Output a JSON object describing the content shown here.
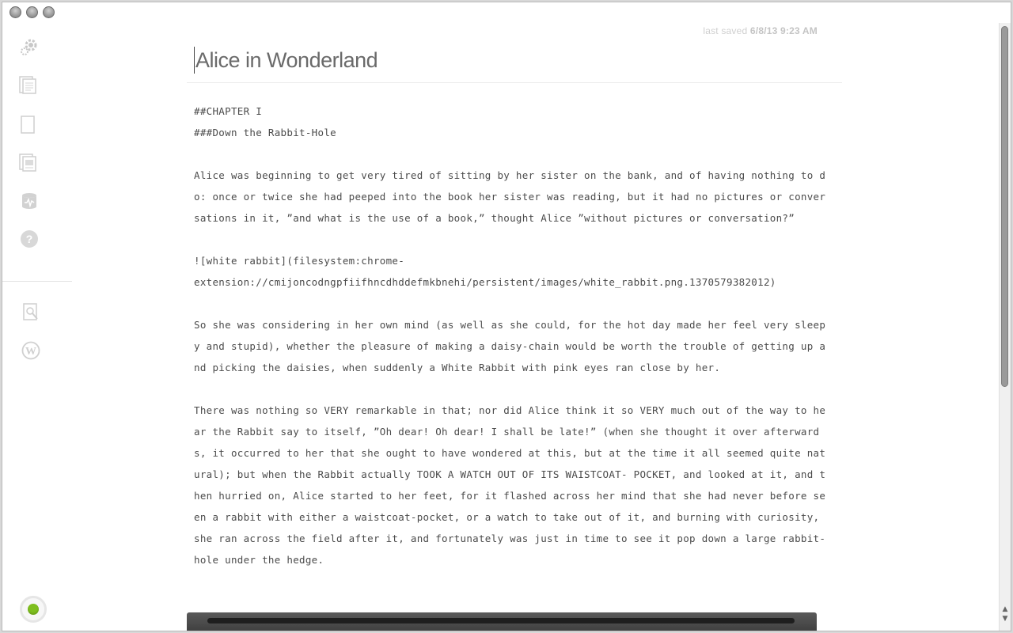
{
  "window": {
    "controls": [
      "close-button",
      "minimize-button",
      "zoom-button"
    ]
  },
  "sidebar": {
    "items": [
      {
        "name": "settings",
        "icon": "gear-icon"
      },
      {
        "name": "documents",
        "icon": "documents-icon"
      },
      {
        "name": "new-document",
        "icon": "blank-page-icon"
      },
      {
        "name": "gallery",
        "icon": "image-pages-icon"
      },
      {
        "name": "storage",
        "icon": "database-icon"
      },
      {
        "name": "help",
        "icon": "help-icon"
      }
    ],
    "tools": [
      {
        "name": "preview",
        "icon": "preview-icon"
      },
      {
        "name": "wordpress",
        "icon": "wordpress-icon"
      }
    ],
    "status_color": "#7fbf1f"
  },
  "header": {
    "last_saved_label": "last saved",
    "last_saved_value": "6/8/13 9:23 AM",
    "title": "Alice in Wonderland"
  },
  "editor": {
    "lines_block1": [
      "##CHAPTER I",
      "###Down the Rabbit-Hole"
    ],
    "para1": "Alice was beginning to get very tired of sitting by her sister on the bank, and of having nothing to do: once or twice she had peeped into the book her sister was reading, but it had no pictures or conversations in it, ”and what is the use of a book,” thought Alice ”without pictures or conversation?”",
    "para2_line1": "![white rabbit](filesystem:chrome-",
    "para2_line2": "extension://cmijoncodngpfiifhncdhddefmkbnehi/persistent/images/white_rabbit.png.1370579382012)",
    "para3": "So she was considering in her own mind (as well as she could, for the hot day made her feel very sleepy and stupid), whether the pleasure of making a daisy-chain would be worth the trouble of getting up and picking the daisies, when suddenly a White Rabbit with pink eyes ran close by her.",
    "para4": "There was nothing so VERY remarkable in that; nor did Alice think it so VERY much out of the way to hear the Rabbit say to itself, ”Oh dear! Oh dear! I shall be late!” (when she thought it over afterwards, it occurred to her that she ought to have wondered at this, but at the time it all seemed quite natural); but when the Rabbit actually TOOK A WATCH OUT OF ITS WAISTCOAT- POCKET, and looked at it, and then hurried on, Alice started to her feet, for it flashed across her mind that she had never before seen a rabbit with either a waistcoat-pocket, or a watch to take out of it, and burning with curiosity, she ran across the field after it, and fortunately was just in time to see it pop down a large rabbit-hole under the hedge."
  },
  "colors": {
    "accent": "#7fbf1f",
    "text": "#4b4b4b",
    "icon": "#c8c8c8"
  }
}
